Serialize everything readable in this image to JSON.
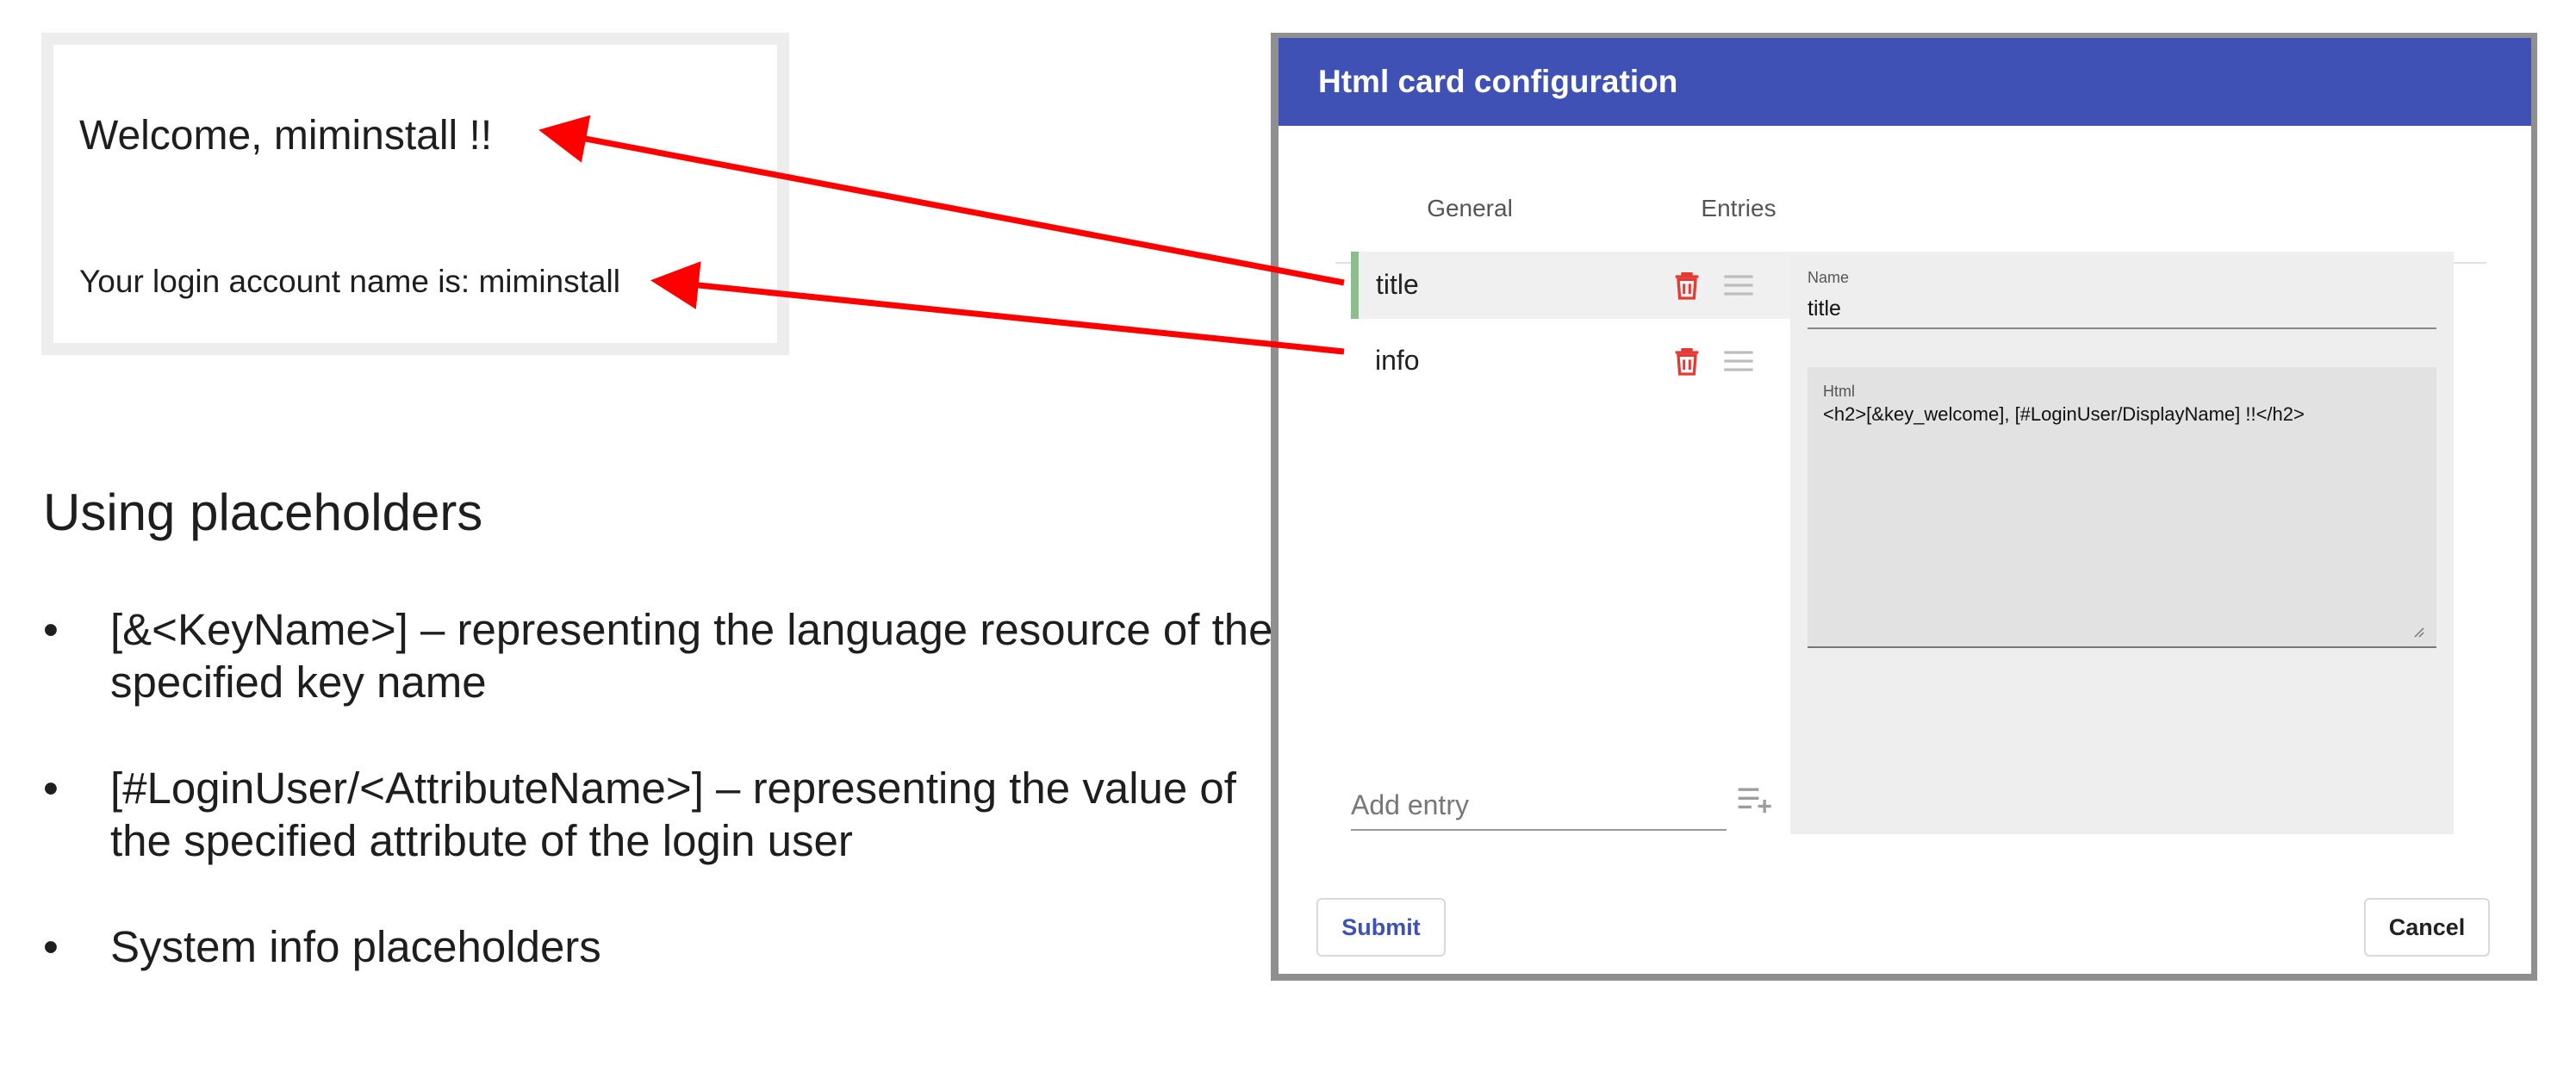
{
  "preview": {
    "welcome": "Welcome, miminstall !!",
    "login": "Your login account name is: miminstall"
  },
  "slide": {
    "heading": "Using placeholders",
    "bullet_char": "•",
    "bullets": [
      "[&<KeyName>] – representing the language resource of the specified key name",
      "[#LoginUser/<AttributeName>] – representing the value of the specified attribute of the login user",
      "System info placeholders"
    ]
  },
  "dialog": {
    "title": "Html card configuration",
    "tabs": [
      {
        "label": "General",
        "active": false
      },
      {
        "label": "Entries",
        "active": true
      }
    ],
    "entries": [
      {
        "label": "title",
        "selected": true
      },
      {
        "label": "info",
        "selected": false
      }
    ],
    "add_entry_placeholder": "Add entry",
    "details": {
      "name_label": "Name",
      "name_value": "title",
      "html_label": "Html",
      "html_value": "<h2>[&key_welcome], [#LoginUser/DisplayName] !!</h2>"
    },
    "buttons": {
      "submit": "Submit",
      "cancel": "Cancel"
    }
  },
  "colors": {
    "header": "#3f51b5",
    "arrow": "#ff0000",
    "delete_icon": "#e53935",
    "selected_marker": "#8fbc8f"
  },
  "icons": {
    "delete": "trash-icon",
    "reorder": "drag-handle-icon",
    "add": "playlist-add-icon"
  }
}
